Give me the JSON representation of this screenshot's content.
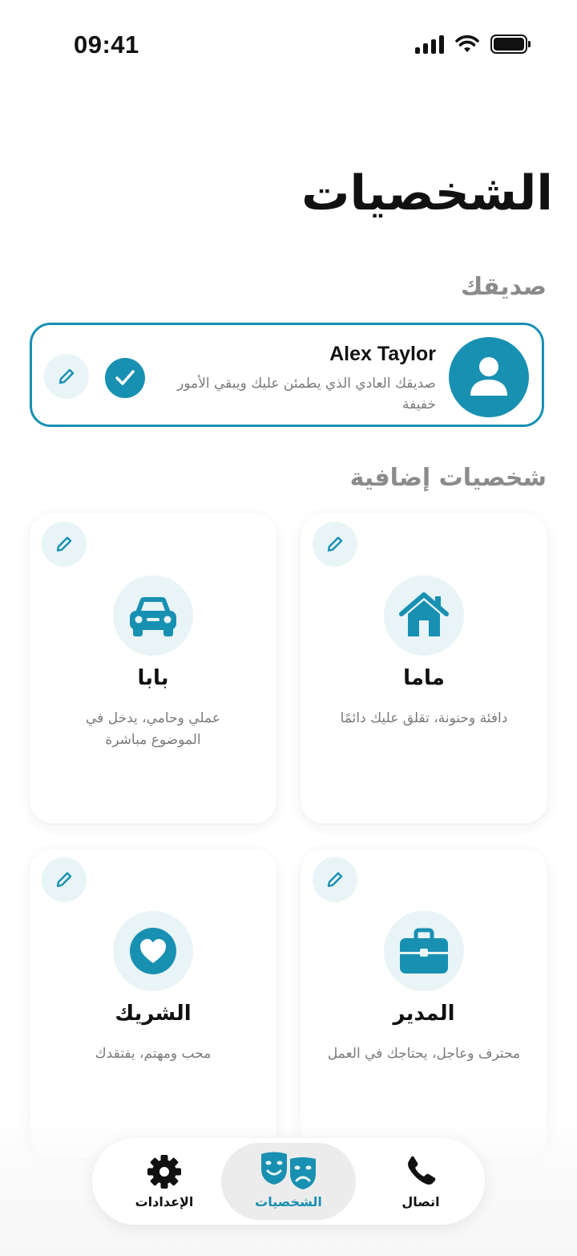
{
  "status_bar": {
    "time": "09:41"
  },
  "page": {
    "title": "الشخصيات"
  },
  "friend_section": {
    "label": "صديقك",
    "name": "Alex Taylor",
    "description": "صديقك العادي الذي يطمئن عليك ويبقي الأمور خفيفة",
    "selected": true
  },
  "extra_section": {
    "label": "شخصيات إضافية",
    "personas": [
      {
        "name": "ماما",
        "description": "دافئة وحنونة، تقلق عليك دائمًا",
        "icon": "house-icon"
      },
      {
        "name": "بابا",
        "description": "عملي وحامي، يدخل في الموضوع مباشرة",
        "icon": "car-icon"
      },
      {
        "name": "المدير",
        "description": "محترف وعاجل، يحتاجك في العمل",
        "icon": "briefcase-icon"
      },
      {
        "name": "الشريك",
        "description": "محب ومهتم، يفتقدك",
        "icon": "heart-icon"
      }
    ]
  },
  "bottom_nav": {
    "items": [
      {
        "label": "اتصال",
        "icon": "phone-icon",
        "active": false
      },
      {
        "label": "الشخصيات",
        "icon": "theater-masks-icon",
        "active": true
      },
      {
        "label": "الإعدادات",
        "icon": "gear-icon",
        "active": false
      }
    ]
  },
  "colors": {
    "accent": "#1890b2",
    "accent_light": "#e8f4f6",
    "muted_text": "#7a7a7a"
  }
}
